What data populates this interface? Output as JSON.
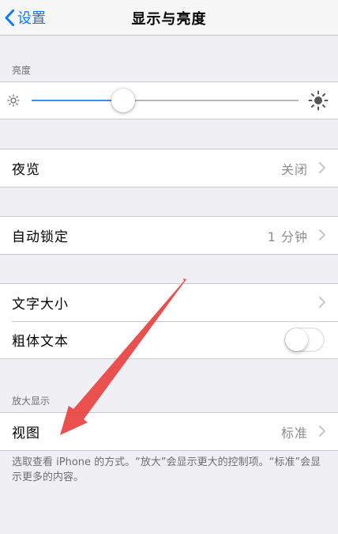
{
  "nav": {
    "back_label": "设置",
    "title": "显示与亮度"
  },
  "brightness": {
    "header": "亮度",
    "level": 0.33
  },
  "rows": {
    "night_shift": {
      "label": "夜览",
      "value": "关闭"
    },
    "auto_lock": {
      "label": "自动锁定",
      "value": "1 分钟"
    },
    "text_size": {
      "label": "文字大小"
    },
    "bold_text": {
      "label": "粗体文本",
      "on": false
    }
  },
  "zoom": {
    "header": "放大显示",
    "view_label": "视图",
    "view_value": "标准",
    "footer": "选取查看 iPhone 的方式。“放大”会显示更大的控制项。“标准”会显示更多的内容。"
  },
  "colors": {
    "accent": "#0a7aff",
    "annotation_arrow": "#e8423f"
  }
}
